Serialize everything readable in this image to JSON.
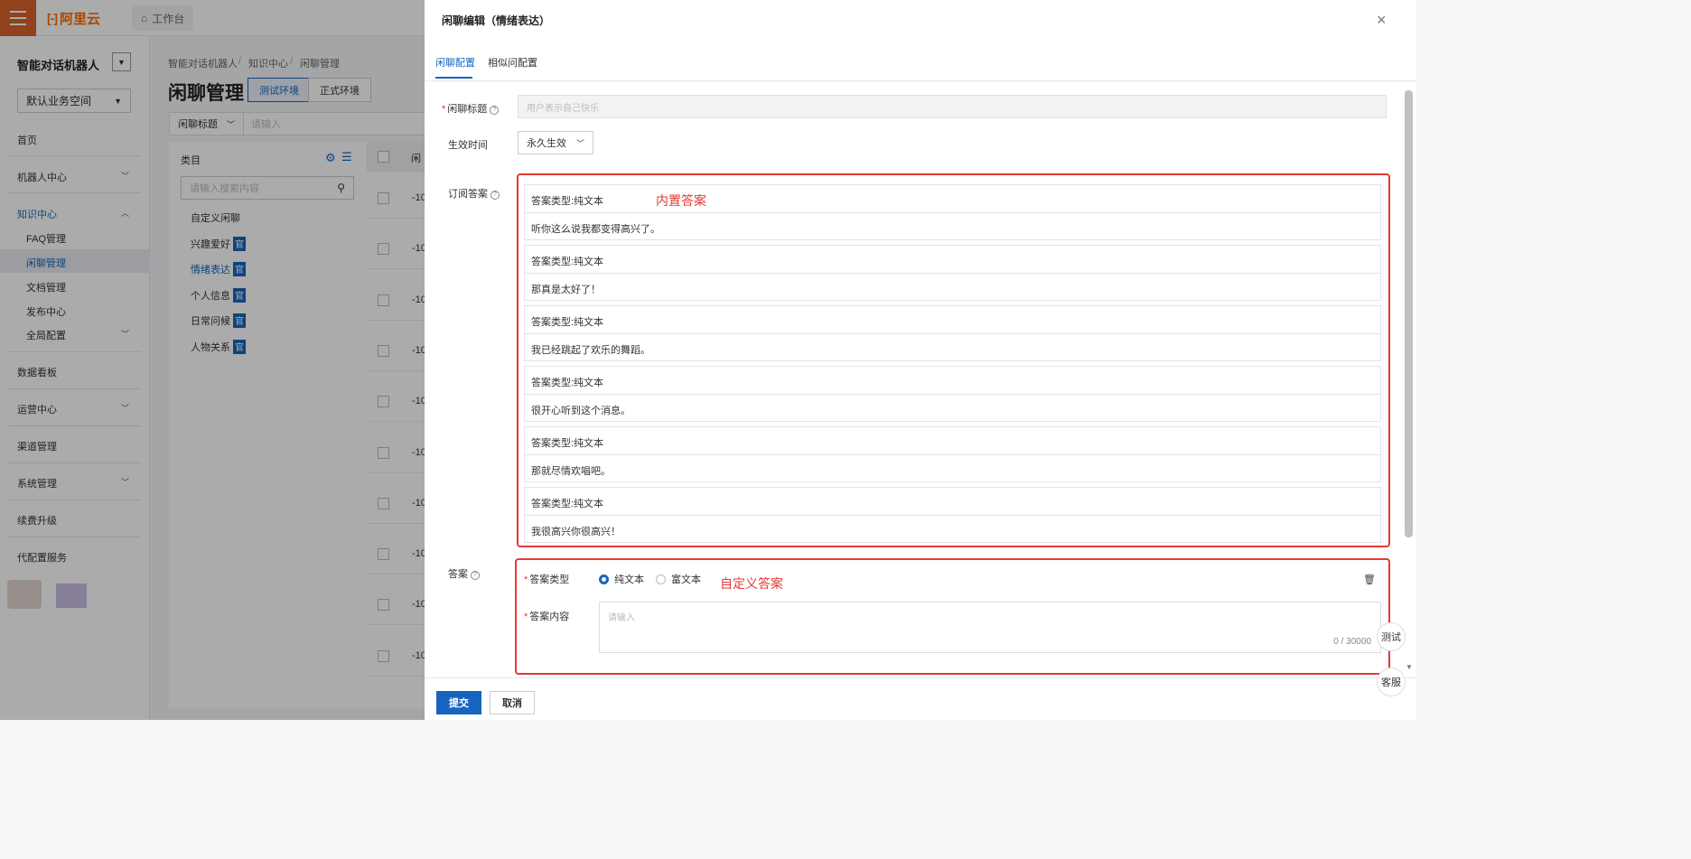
{
  "header": {
    "brand": "阿里云",
    "workbench": "工作台"
  },
  "sidebar": {
    "app_title": "智能对话机器人",
    "space": "默认业务空间",
    "items": {
      "home": "首页",
      "robot_center": "机器人中心",
      "knowledge_center": "知识中心",
      "faq": "FAQ管理",
      "chitchat": "闲聊管理",
      "docs": "文档管理",
      "publish": "发布中心",
      "global_config": "全局配置",
      "dashboard": "数据看板",
      "ops": "运营中心",
      "channels": "渠道管理",
      "system": "系统管理",
      "renew": "续费升级",
      "proxy_config": "代配置服务"
    }
  },
  "main": {
    "breadcrumb": [
      "智能对话机器人",
      "知识中心",
      "闲聊管理"
    ],
    "title": "闲聊管理",
    "env_test": "测试环境",
    "env_prod": "正式环境",
    "filter_field": "闲聊标题",
    "filter_placeholder": "请输入",
    "category_header": "类目",
    "category_search_placeholder": "请输入搜索内容",
    "official_badge": "官",
    "categories": [
      "自定义闲聊",
      "兴趣爱好",
      "情绪表达",
      "个人信息",
      "日常问候",
      "人物关系"
    ],
    "table_col": "闲",
    "row_value": "-10"
  },
  "drawer": {
    "title": "闲聊编辑（情绪表达）",
    "tabs": [
      "闲聊配置",
      "相似问配置"
    ],
    "label_title": "闲聊标题",
    "title_placeholder": "用户表示自己快乐",
    "label_effective": "生效时间",
    "effective_value": "永久生效",
    "label_subscribed": "订阅答案",
    "answer_type_label": "答案类型:纯文本",
    "answers": [
      "听你这么说我都变得高兴了。",
      "那真是太好了！",
      "我已经跳起了欢乐的舞蹈。",
      "很开心听到这个消息。",
      "那就尽情欢唱吧。",
      "我很高兴你很高兴！"
    ],
    "annotation_builtin": "内置答案",
    "label_answer": "答案",
    "label_answer_type": "答案类型",
    "radio_plain": "纯文本",
    "radio_rich": "富文本",
    "annotation_custom": "自定义答案",
    "label_answer_content": "答案内容",
    "content_placeholder": "请输入",
    "char_count": "0 / 30000",
    "submit": "提交",
    "cancel": "取消",
    "float_test": "测试",
    "float_service": "客服"
  }
}
